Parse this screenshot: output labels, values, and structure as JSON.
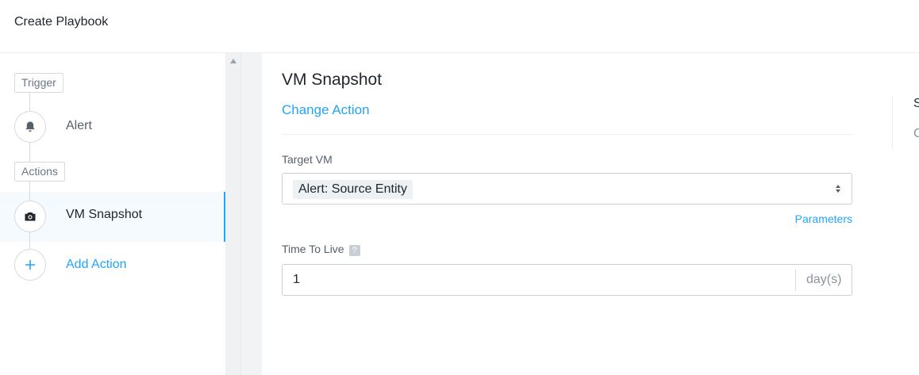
{
  "header": {
    "title": "Create Playbook"
  },
  "sidebar": {
    "trigger_tag": "Trigger",
    "trigger_step": {
      "label": "Alert",
      "icon": "bell-icon"
    },
    "actions_tag": "Actions",
    "action_steps": [
      {
        "label": "VM Snapshot",
        "icon": "camera-icon",
        "selected": true
      }
    ],
    "add_action": {
      "label": "Add Action",
      "icon": "plus-icon"
    }
  },
  "main": {
    "action_title": "VM Snapshot",
    "change_action": "Change Action",
    "target_vm": {
      "label": "Target VM",
      "selected": "Alert: Source Entity"
    },
    "parameters_link": "Parameters",
    "ttl": {
      "label": "Time To Live",
      "help": "?",
      "value": "1",
      "unit": "day(s)"
    }
  },
  "right_panel": {
    "heading_partial": "S",
    "text_partial": "C"
  },
  "colors": {
    "accent": "#22a5f7",
    "selected_bg": "#f4fafe"
  }
}
